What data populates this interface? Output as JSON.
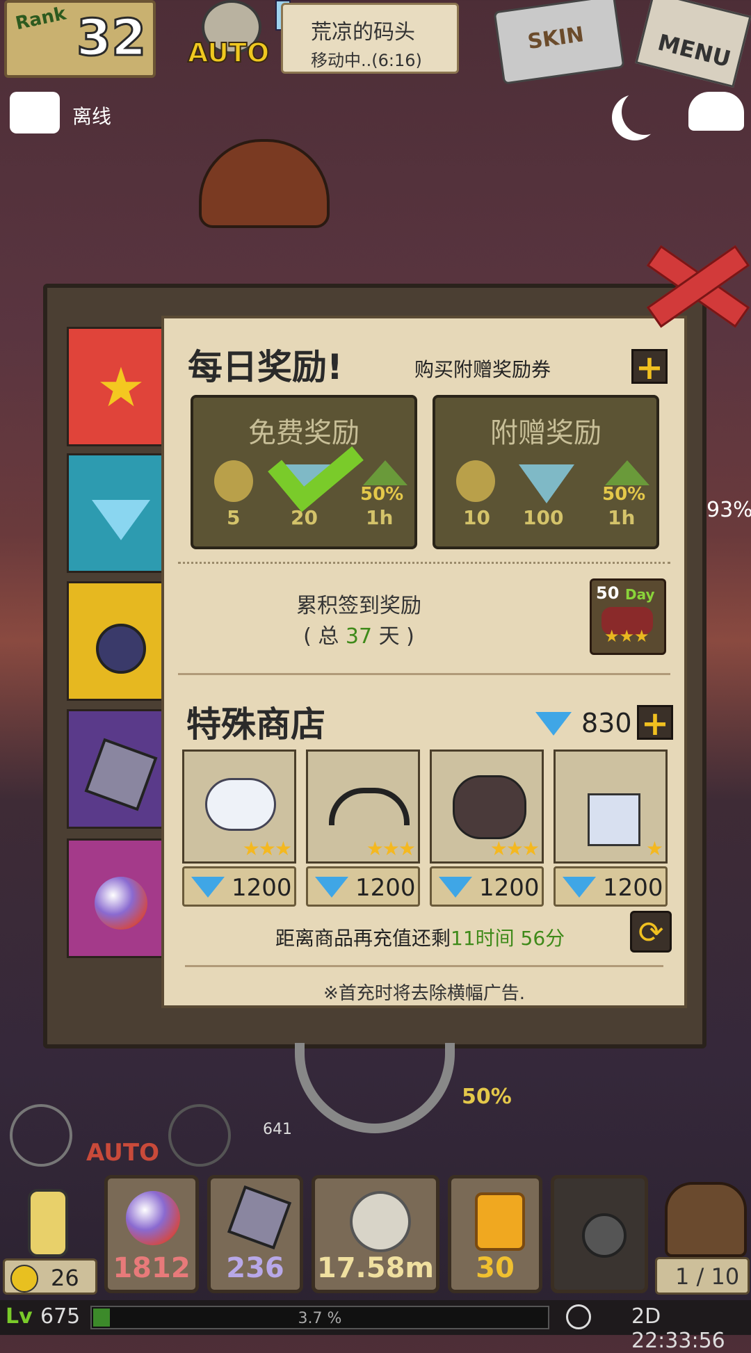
{
  "top": {
    "rank_label": "Rank",
    "rank_value": "32",
    "auto_label": "AUTO",
    "quest_location": "荒凉的码头",
    "quest_status": "移动中..(6:16)",
    "skin_label": "SKIN",
    "menu_label": "MENU",
    "chat_status": "离线"
  },
  "panel": {
    "daily_title": "每日奖励!",
    "buy_voucher": "购买附赠奖励券",
    "free_card": {
      "title": "免费奖励",
      "potion": "5",
      "gem": "20",
      "pct": "50%",
      "dur": "1h"
    },
    "bonus_card": {
      "title": "附赠奖励",
      "potion": "10",
      "gem": "100",
      "pct": "50%",
      "dur": "1h"
    },
    "cumulative_label": "累积签到奖励",
    "cumulative_prefix": "( 总 ",
    "cumulative_days": "37",
    "cumulative_suffix": " 天 )",
    "day_badge_num": "50",
    "day_badge_word": "Day",
    "shop_title": "特殊商店",
    "gem_count": "830",
    "items": [
      {
        "icon": "teapot-icon",
        "stars": "★★★",
        "price": "1200"
      },
      {
        "icon": "weapon-icon",
        "stars": "★★★",
        "price": "1200"
      },
      {
        "icon": "cat-mask-icon",
        "stars": "★★★",
        "price": "1200"
      },
      {
        "icon": "trident-icon",
        "stars": "★",
        "price": "1200"
      }
    ],
    "restock_prefix": "距离商品再充值还剩",
    "restock_time": "11时间 56分",
    "note": "※首充时将去除横幅广告."
  },
  "side_pct": "93%",
  "hud": {
    "auto_label": "AUTO",
    "dist": "641",
    "boost": "50%",
    "orbs": "1812",
    "shields": "236",
    "shells": "17.58m",
    "amber": "30",
    "coins": "26",
    "capacity": "1 / 10",
    "level": "675",
    "exp_text": "3.7 %",
    "exp_fraction": 0.037,
    "clock": "2D 22:33:56"
  },
  "colors": {
    "tab_star": "#e0443a",
    "tab_gem": "#2d9bb0",
    "tab_potion": "#e6b820",
    "tab_shield": "#5a3a8a",
    "tab_orb": "#a43a8a"
  }
}
